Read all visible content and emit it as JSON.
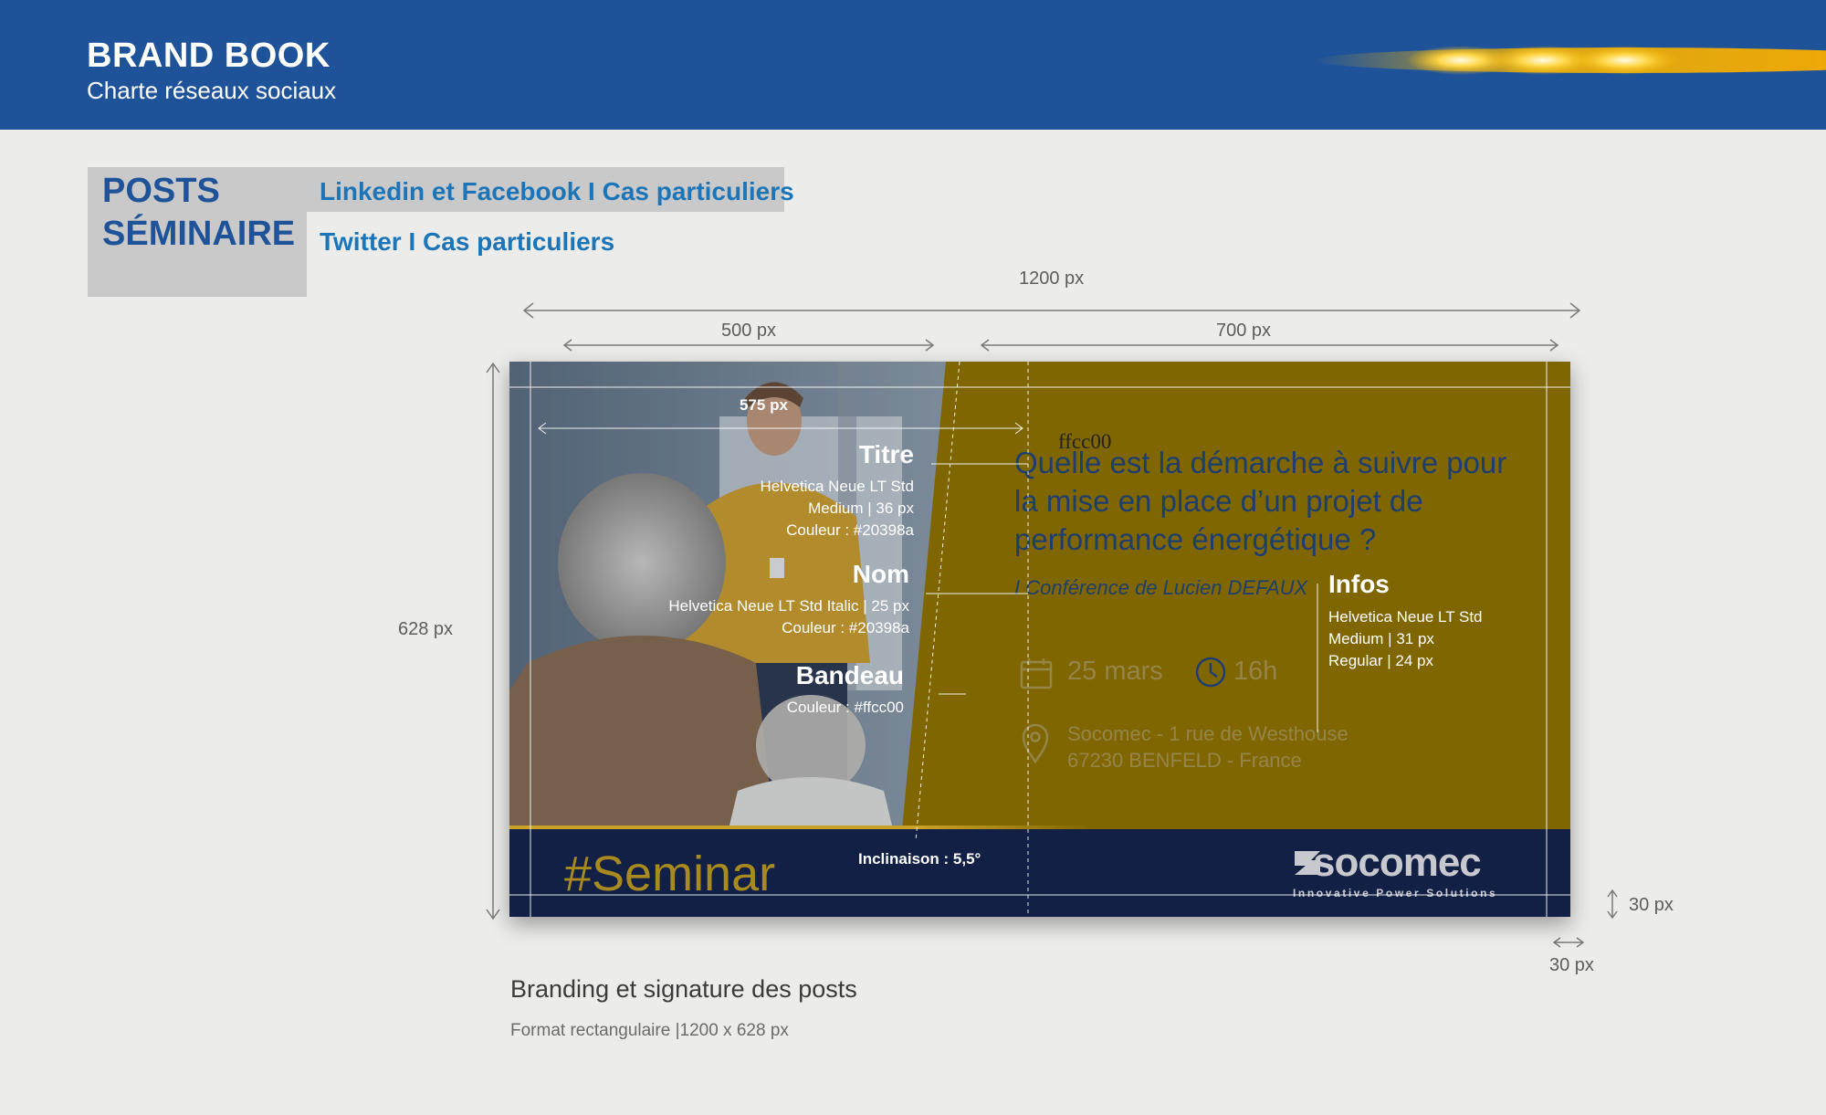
{
  "header": {
    "title": "BRAND BOOK",
    "subtitle": "Charte réseaux sociaux"
  },
  "section": {
    "title_line1": "POSTS",
    "title_line2": "SÉMINAIRE",
    "tab_linkedin": "Linkedin et Facebook I Cas particuliers",
    "tab_twitter": "Twitter I Cas particuliers"
  },
  "dimensions": {
    "total_width": "1200 px",
    "left_width": "500 px",
    "right_width": "700 px",
    "inner_width": "575 px",
    "height": "628 px",
    "margin_v": "30 px",
    "margin_h": "30 px"
  },
  "post": {
    "question": "Quelle est la démarche à suivre pour la mise en place d’un projet de performance énergétique ?",
    "speaker": "I Conférence de Lucien DEFAUX",
    "date": "25 mars",
    "hour": "16h",
    "address_line1": "Socomec - 1 rue de Westhouse",
    "address_line2": "67230 BENFELD - France",
    "hashtag": "#Seminar",
    "logo_name": "socomec",
    "logo_tagline": "Innovative Power Solutions",
    "colour_label": "ffcc00"
  },
  "annotations": {
    "titre": {
      "heading": "Titre",
      "line1": "Helvetica Neue LT Std",
      "line2": "Medium | 36 px",
      "line3": "Couleur : #20398a"
    },
    "nom": {
      "heading": "Nom",
      "line1": "Helvetica Neue LT Std Italic | 25 px",
      "line2": "Couleur : #20398a"
    },
    "bandeau": {
      "heading": "Bandeau",
      "line1": "Couleur : #ffcc00"
    },
    "infos": {
      "heading": "Infos",
      "line1": "Helvetica Neue LT Std",
      "line2": "Medium | 31 px",
      "line3": "Regular | 24 px"
    },
    "inclinaison": "Inclinaison : 5,5°"
  },
  "caption": {
    "title": "Branding et signature des posts",
    "subtitle": "Format rectangulaire |1200 x 628 px"
  },
  "colors": {
    "header_blue": "#1f5399",
    "title_blue": "#20398a",
    "banner_yellow": "#ffcc00",
    "band_navy": "#122045"
  }
}
